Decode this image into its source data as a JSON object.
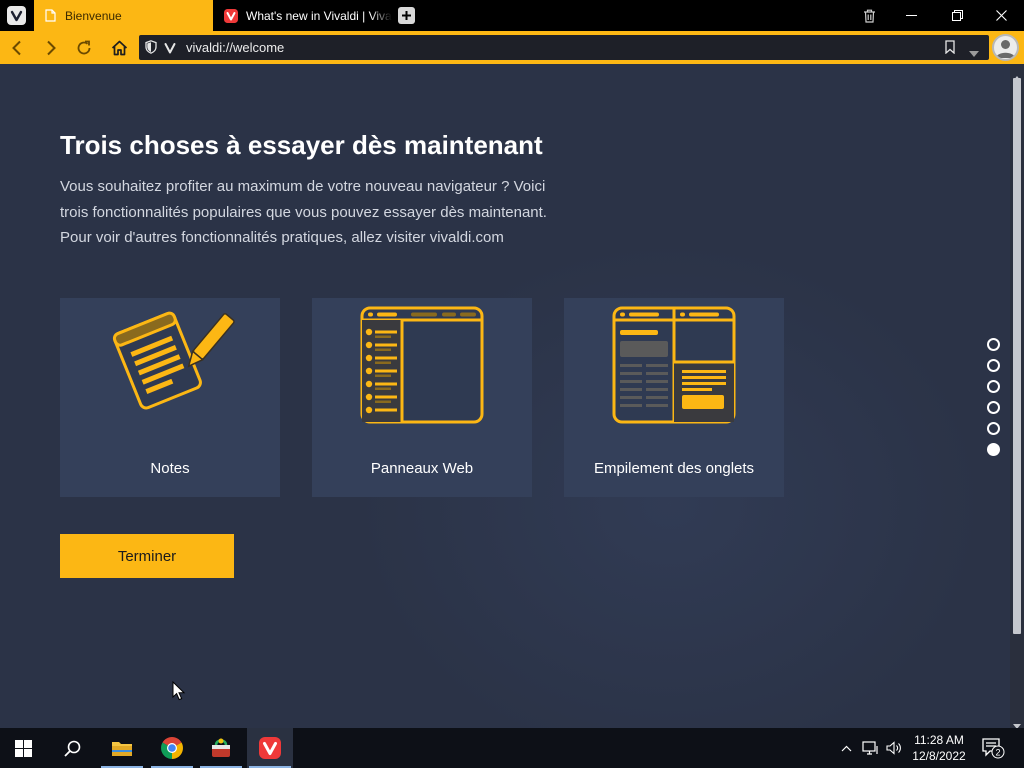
{
  "tabs": [
    {
      "title": "Bienvenue",
      "active": true
    },
    {
      "title": "What's new in Vivaldi | Vivaldi",
      "active": false
    }
  ],
  "window_controls": {
    "trash_icon": "trash-icon",
    "minimize": "minimize-icon",
    "restore": "restore-icon",
    "close": "close-icon"
  },
  "address_bar": {
    "url": "vivaldi://welcome"
  },
  "page": {
    "heading": "Trois choses à essayer dès maintenant",
    "intro_lines": [
      "Vous souhaitez profiter au maximum de votre nouveau navigateur ? Voici",
      "trois fonctionnalités populaires que vous pouvez essayer dès maintenant.",
      "Pour voir d'autres fonctionnalités pratiques, allez visiter vivaldi.com"
    ],
    "cards": [
      {
        "label": "Notes",
        "icon": "notes-icon"
      },
      {
        "label": "Panneaux Web",
        "icon": "web-panels-icon"
      },
      {
        "label": "Empilement des onglets",
        "icon": "tab-stacking-icon"
      }
    ],
    "finish_button": "Terminer",
    "progress": {
      "total_steps": 6,
      "current_step": 6
    }
  },
  "taskbar": {
    "apps": [
      "start-icon",
      "search-icon",
      "file-explorer-icon",
      "chrome-icon",
      "app-icon",
      "vivaldi-icon"
    ],
    "clock": {
      "time": "11:28 AM",
      "date": "12/8/2022"
    },
    "notifications_count": "2"
  },
  "colors": {
    "accent": "#fcb714",
    "background": "#2b3347",
    "card": "#34405a",
    "tab_bar": "#000000"
  }
}
